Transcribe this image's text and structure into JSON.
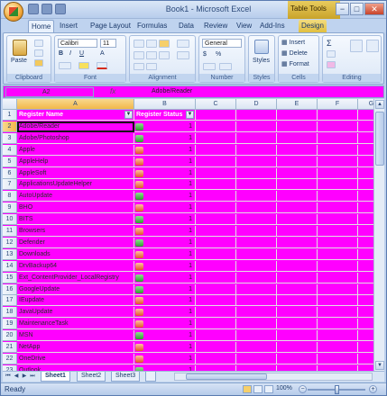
{
  "window": {
    "title": "Book1 - Microsoft Excel",
    "context_title": "Table Tools",
    "min": "−",
    "max": "□",
    "close": "✕"
  },
  "tabs": [
    "Home",
    "Insert",
    "Page Layout",
    "Formulas",
    "Data",
    "Review",
    "View",
    "Add-Ins",
    "Design"
  ],
  "ribbon": {
    "clipboard": {
      "label": "Clipboard",
      "paste": "Paste"
    },
    "font": {
      "label": "Font",
      "name": "Calibri",
      "size": "11"
    },
    "alignment": {
      "label": "Alignment"
    },
    "number": {
      "label": "Number",
      "format": "General",
      "currency": "$",
      "percent": "%"
    },
    "styles": {
      "label": "Styles",
      "btn": "Styles"
    },
    "cells": {
      "label": "Cells",
      "insert": "Insert",
      "delete": "Delete",
      "format": "Format"
    },
    "editing": {
      "label": "Editing"
    }
  },
  "formula_bar": {
    "name_box": "A2",
    "fx": "fx",
    "content": "Adobe/Reader"
  },
  "grid": {
    "columns": [
      "A",
      "B",
      "C",
      "D",
      "E",
      "F",
      "G"
    ],
    "header_row": {
      "a": "Register Name",
      "b": "Register Status"
    },
    "rows": [
      {
        "n": "2",
        "name": "Adobe/Reader",
        "status": "ok",
        "val": "1"
      },
      {
        "n": "3",
        "name": "Adobe/Photoshop",
        "status": "ok",
        "val": "1"
      },
      {
        "n": "4",
        "name": "Apple",
        "status": "err",
        "val": "1"
      },
      {
        "n": "5",
        "name": "AppleHelp",
        "status": "err",
        "val": "1"
      },
      {
        "n": "6",
        "name": "AppleSoft",
        "status": "err",
        "val": "1"
      },
      {
        "n": "7",
        "name": "ApplicationsUpdateHelper",
        "status": "err",
        "val": "1"
      },
      {
        "n": "8",
        "name": "AutoUpdate",
        "status": "ok",
        "val": "1"
      },
      {
        "n": "9",
        "name": "BHO",
        "status": "err",
        "val": "1"
      },
      {
        "n": "10",
        "name": "BITS",
        "status": "ok",
        "val": "1"
      },
      {
        "n": "11",
        "name": "Browsers",
        "status": "err",
        "val": "1"
      },
      {
        "n": "12",
        "name": "Defender",
        "status": "ok",
        "val": "1"
      },
      {
        "n": "13",
        "name": "Downloads",
        "status": "err",
        "val": "1"
      },
      {
        "n": "14",
        "name": "DrvBackup64",
        "status": "err",
        "val": "1"
      },
      {
        "n": "15",
        "name": "Ext_ContentProvider_LocalRegistry",
        "status": "ok",
        "val": "1"
      },
      {
        "n": "16",
        "name": "GoogleUpdate",
        "status": "ok",
        "val": "1"
      },
      {
        "n": "17",
        "name": "IEupdate",
        "status": "err",
        "val": "1"
      },
      {
        "n": "18",
        "name": "JavaUpdate",
        "status": "err",
        "val": "1"
      },
      {
        "n": "19",
        "name": "MaintenanceTask",
        "status": "err",
        "val": "1"
      },
      {
        "n": "20",
        "name": "MSN",
        "status": "ok",
        "val": "1"
      },
      {
        "n": "21",
        "name": "NetApp",
        "status": "err",
        "val": "1"
      },
      {
        "n": "22",
        "name": "OneDrive",
        "status": "err",
        "val": "1"
      },
      {
        "n": "23",
        "name": "Outlook",
        "status": "ok",
        "val": "1"
      }
    ]
  },
  "sheets": [
    "Sheet1",
    "Sheet2",
    "Sheet3"
  ],
  "status": {
    "ready": "Ready",
    "zoom": "100%"
  }
}
